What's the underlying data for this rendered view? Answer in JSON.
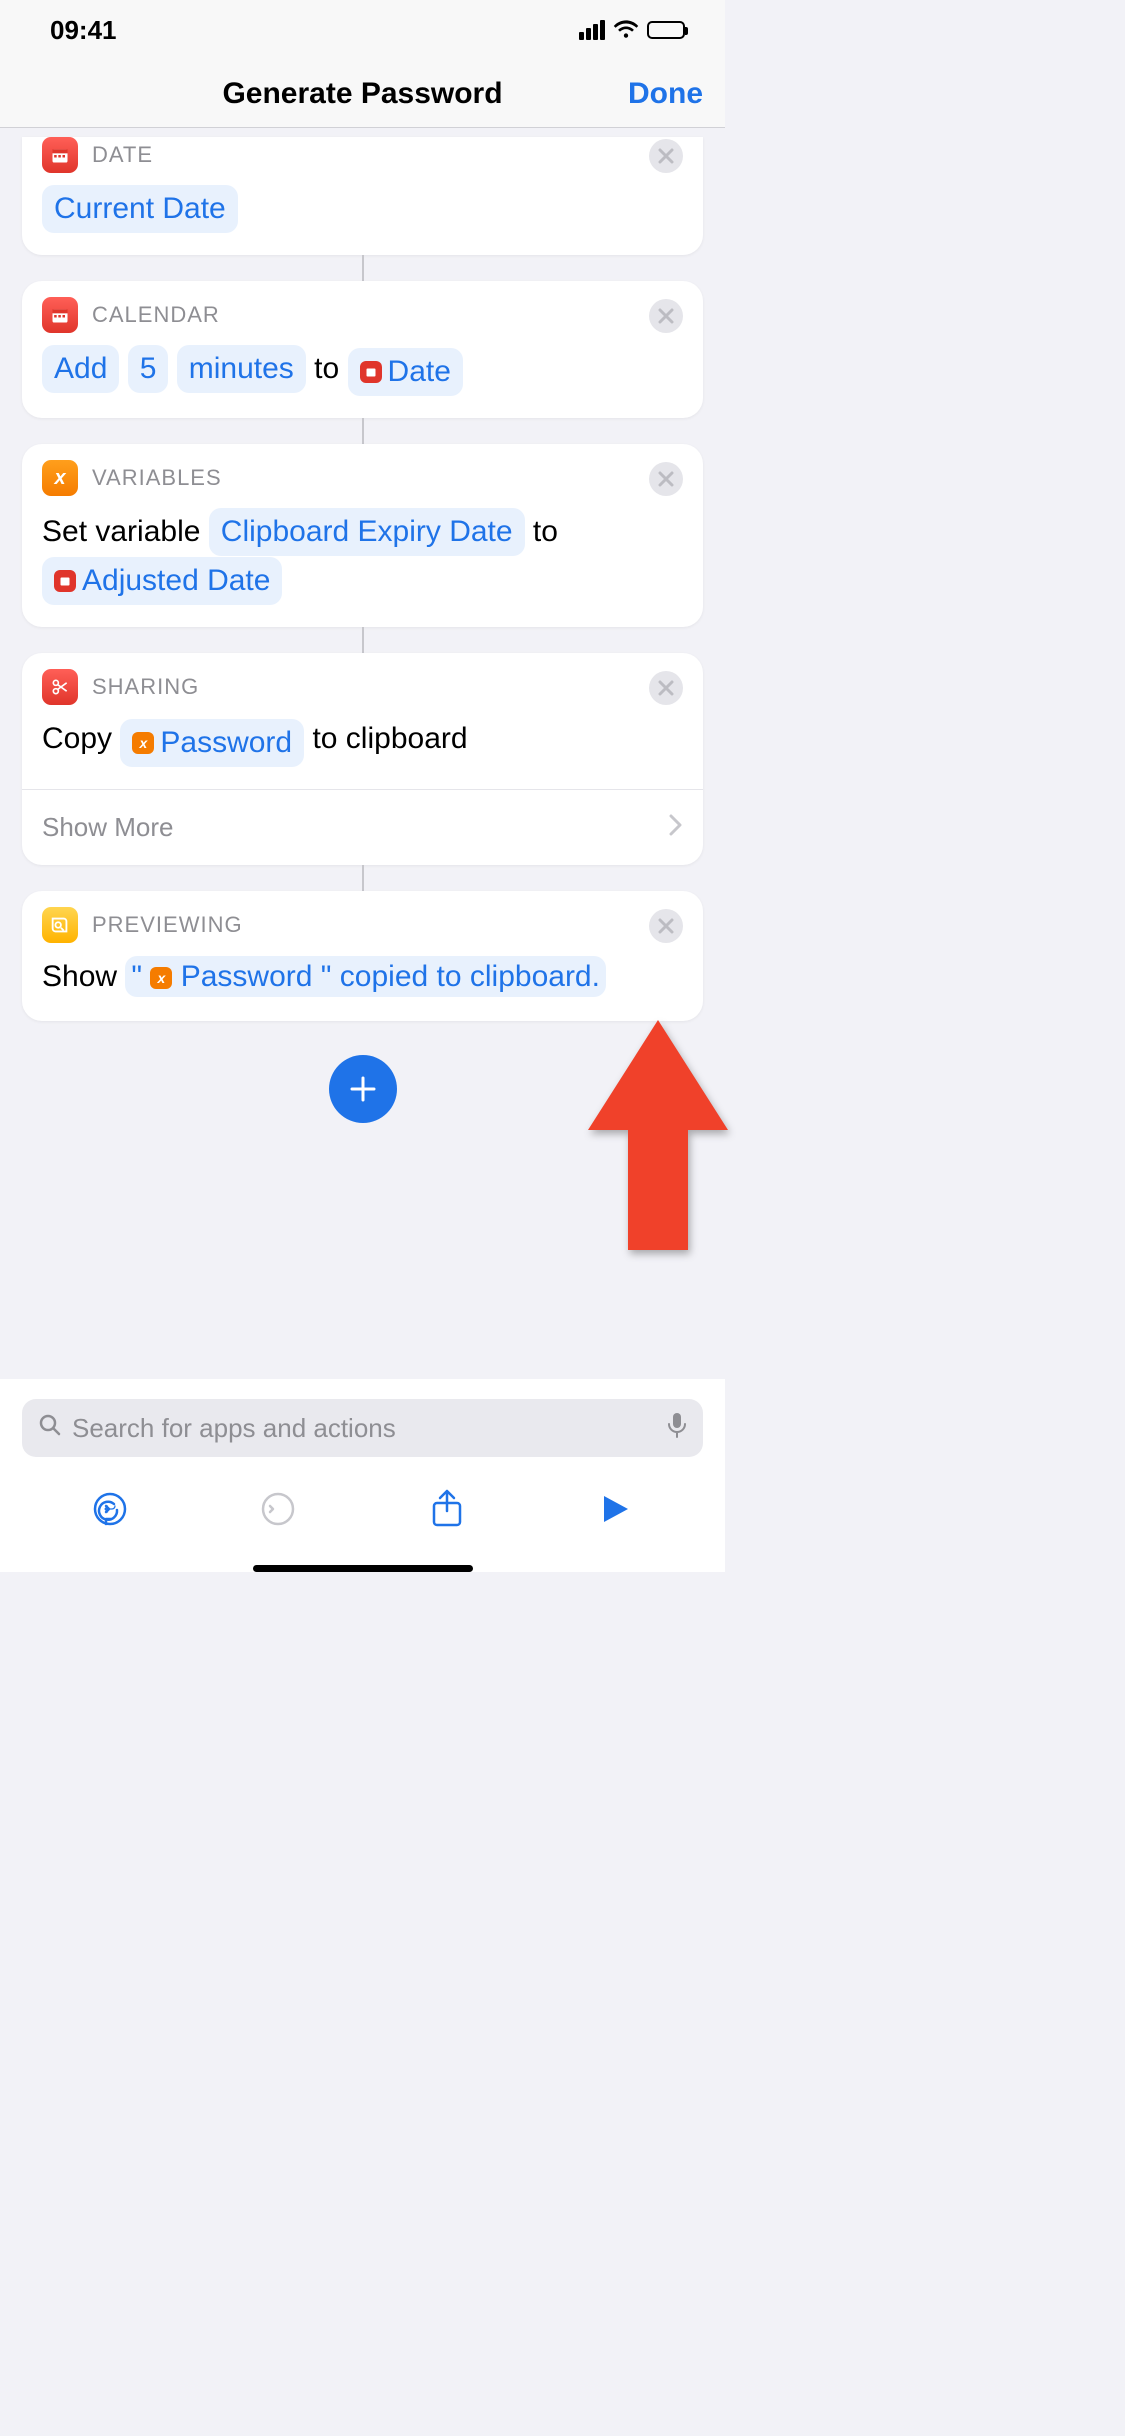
{
  "status": {
    "time": "09:41"
  },
  "nav": {
    "title": "Generate Password",
    "done": "Done"
  },
  "actions": [
    {
      "app": "DATE",
      "content": {
        "pill_current_date": "Current Date"
      }
    },
    {
      "app": "CALENDAR",
      "content": {
        "add": "Add",
        "num": "5",
        "unit": "minutes",
        "to": "to",
        "date_pill": "Date"
      }
    },
    {
      "app": "VARIABLES",
      "content": {
        "set_variable": "Set variable",
        "var_name": "Clipboard Expiry Date",
        "to": "to",
        "value_pill": "Adjusted Date"
      }
    },
    {
      "app": "SHARING",
      "content": {
        "copy": "Copy",
        "password_pill": "Password",
        "to_clipboard": "to clipboard"
      },
      "show_more": "Show More"
    },
    {
      "app": "PREVIEWING",
      "content": {
        "show": "Show",
        "quote_open": "\"",
        "password_pill": "Password",
        "rest": "\" copied to clipboard."
      }
    }
  ],
  "search": {
    "placeholder": "Search for apps and actions"
  }
}
